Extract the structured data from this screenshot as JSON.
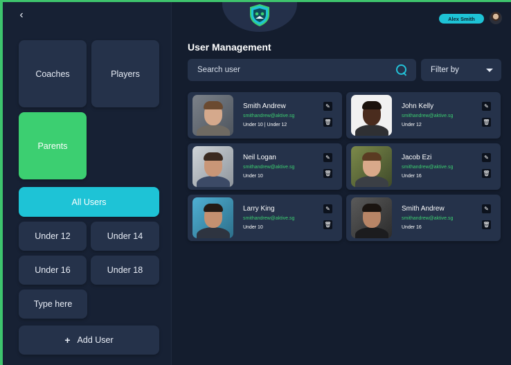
{
  "header": {
    "back_icon": "chevron-left-icon",
    "back_glyph": "‹",
    "logo_icon": "shield-logo-icon",
    "user_name": "Alex Smith",
    "user_avatar_icon": "user-avatar"
  },
  "sidebar": {
    "roles": [
      {
        "label": "Coaches"
      },
      {
        "label": "Players"
      },
      {
        "label": "Parents",
        "active": true
      }
    ],
    "all_users_label": "All Users",
    "groups": [
      {
        "label": "Under 12"
      },
      {
        "label": "Under 14"
      },
      {
        "label": "Under 16"
      },
      {
        "label": "Under 18"
      }
    ],
    "custom_group_placeholder": "Type here",
    "add_user_icon": "plus-icon",
    "add_user_glyph": "+",
    "add_user_label": "Add User"
  },
  "main": {
    "title": "User Management",
    "search": {
      "placeholder": "Search user",
      "icon": "search-icon"
    },
    "filter": {
      "label": "Filter by",
      "icon": "chevron-down-icon"
    },
    "edit_glyph": "✎",
    "delete_glyph": "🗑",
    "users": [
      {
        "name": "Smith Andrew",
        "email": "smithandrew@aktive.sg",
        "groups": "Under 10 | Under 12"
      },
      {
        "name": "John Kelly",
        "email": "smithandrew@aktive.sg",
        "groups": "Under 12"
      },
      {
        "name": "Neil Logan",
        "email": "smithandrew@aktive.sg",
        "groups": "Under 10"
      },
      {
        "name": "Jacob Ezi",
        "email": "smithandrew@aktive.sg",
        "groups": "Under 16"
      },
      {
        "name": "Larry King",
        "email": "smithandrew@aktive.sg",
        "groups": "Under 10"
      },
      {
        "name": "Smith Andrew",
        "email": "smithandrew@aktive.sg",
        "groups": "Under 16"
      }
    ]
  },
  "colors": {
    "accent_green": "#3ccf71",
    "accent_cyan": "#1ec3d6",
    "background": "#141d2e",
    "panel": "#25324a"
  }
}
